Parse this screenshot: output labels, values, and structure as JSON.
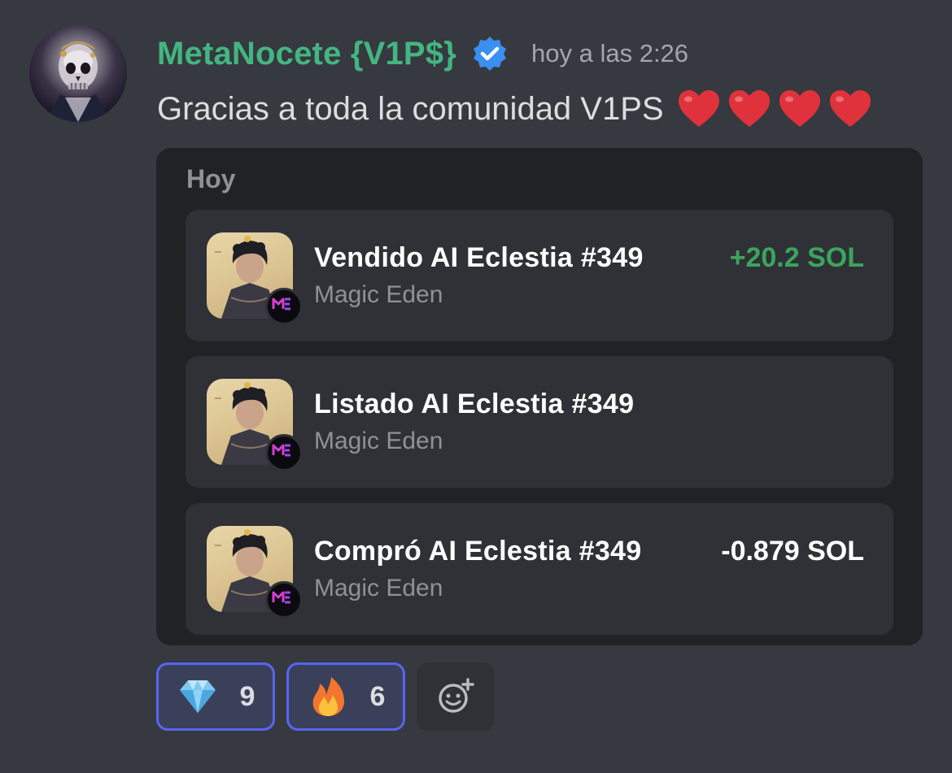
{
  "message": {
    "username": "MetaNocete {V1P$}",
    "timestamp": "hoy a las 2:26",
    "text": "Gracias a toda la comunidad V1PS",
    "heart_count": 4,
    "username_color": "#43b581"
  },
  "embed": {
    "title": "Hoy",
    "activities": [
      {
        "title": "Vendido AI Eclestia #349",
        "source": "Magic Eden",
        "amount": "+20.2 SOL",
        "amount_color": "#3ba55d"
      },
      {
        "title": "Listado AI Eclestia #349",
        "source": "Magic Eden",
        "amount": "",
        "amount_color": "#ffffff"
      },
      {
        "title": "Compró AI Eclestia #349",
        "source": "Magic Eden",
        "amount": "-0.879 SOL",
        "amount_color": "#ffffff"
      }
    ]
  },
  "reactions": [
    {
      "icon": "gem-icon",
      "count": "9"
    },
    {
      "icon": "fire-icon",
      "count": "6"
    }
  ],
  "add_reaction": {
    "icon": "add-reaction-icon"
  }
}
